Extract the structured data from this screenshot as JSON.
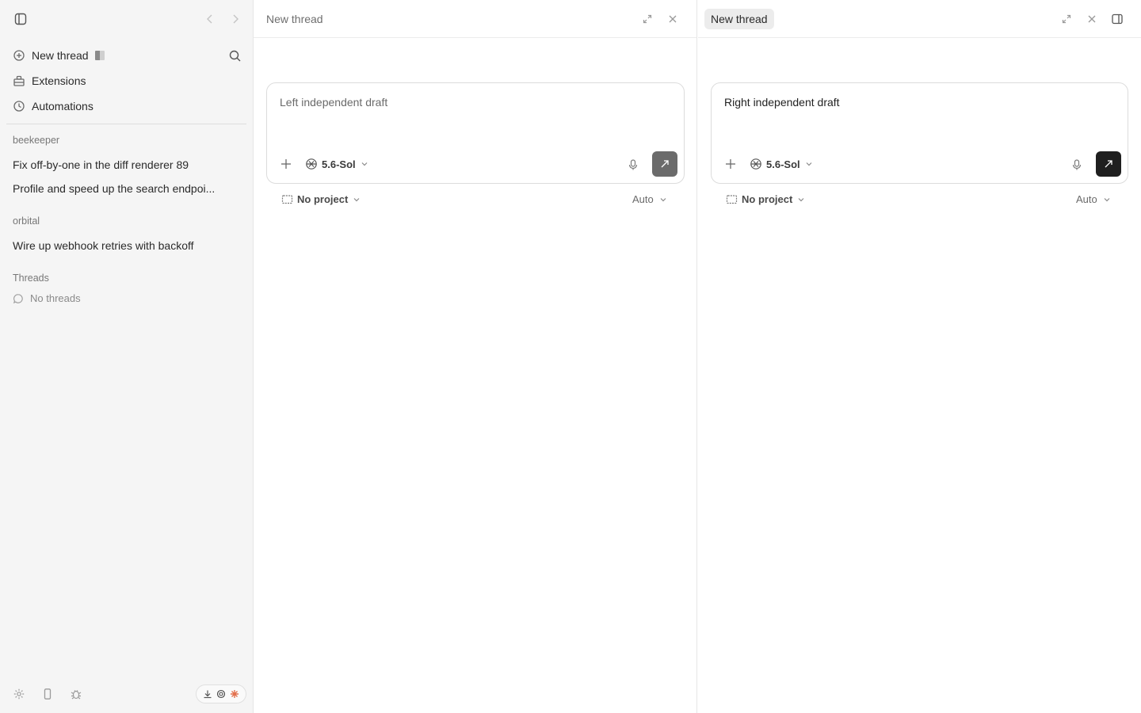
{
  "sidebar": {
    "toggle_icon": "sidebar-panel-icon",
    "nav": {
      "back_icon": "chevron-left-icon",
      "forward_icon": "chevron-right-icon"
    },
    "primary": [
      {
        "label": "New thread",
        "icon": "plus-circle-icon"
      },
      {
        "label": "Extensions",
        "icon": "extensions-icon"
      },
      {
        "label": "Automations",
        "icon": "clock-icon"
      }
    ],
    "search_icon": "search-icon",
    "groups": [
      {
        "label": "beekeeper",
        "threads": [
          "Fix off-by-one in the diff renderer 89",
          "Profile and speed up the search endpoi..."
        ]
      },
      {
        "label": "orbital",
        "threads": [
          "Wire up webhook retries with backoff"
        ]
      }
    ],
    "threads_section": {
      "label": "Threads",
      "empty_text": "No threads"
    },
    "footer": {
      "icons": [
        "settings-icon",
        "mobile-icon",
        "bug-icon"
      ],
      "pill_icons": [
        "download-icon",
        "openai-icon",
        "claude-icon"
      ]
    }
  },
  "panes": [
    {
      "title": "New thread",
      "active": false,
      "draft": "Left independent draft",
      "model": "5.6-Sol",
      "project": "No project",
      "mode": "Auto"
    },
    {
      "title": "New thread",
      "active": true,
      "draft": "Right independent draft",
      "model": "5.6-Sol",
      "project": "No project",
      "mode": "Auto"
    }
  ],
  "colors": {
    "sidebar_bg": "#f5f5f5",
    "send_disabled": "#6b6b6b",
    "send_active": "#1f1f1f",
    "claude_accent": "#e2704c"
  }
}
